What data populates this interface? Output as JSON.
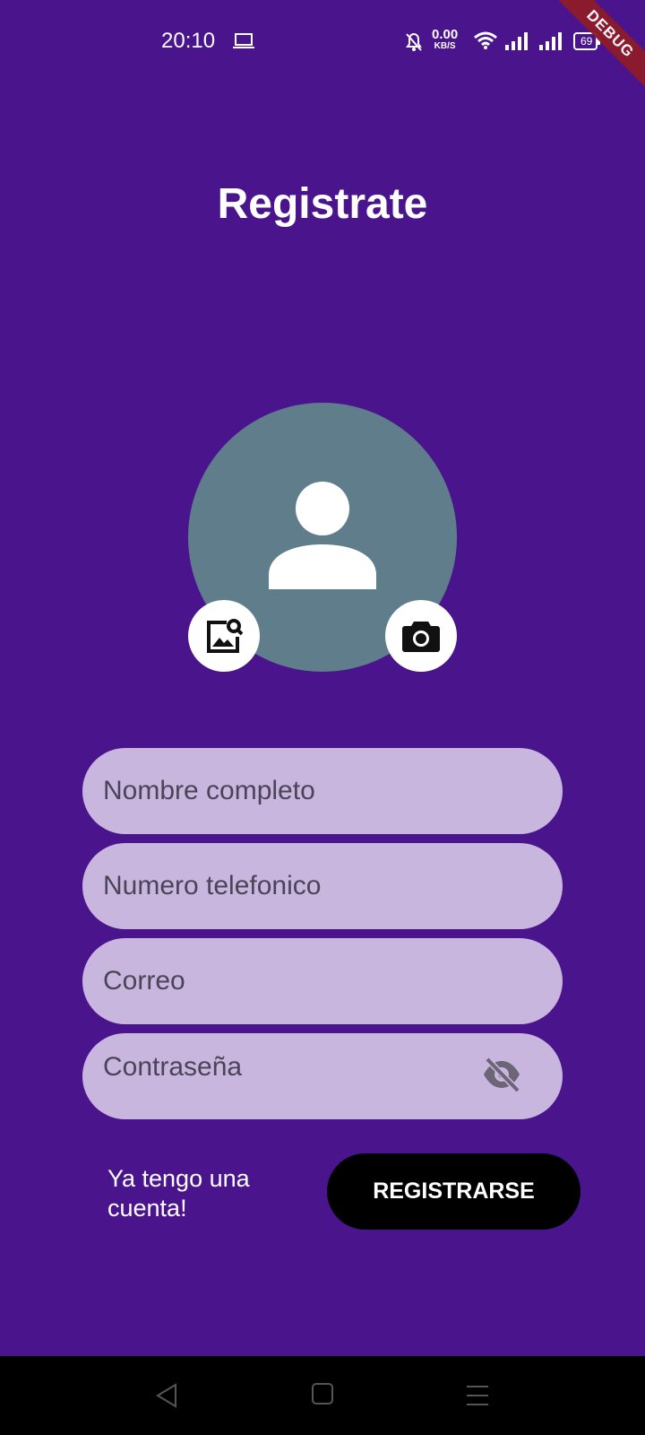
{
  "status_bar": {
    "time": "20:10",
    "net_speed_value": "0.00",
    "net_speed_unit": "KB/S",
    "battery": "69",
    "icons": [
      "laptop-icon",
      "bell-off-icon",
      "wifi-icon",
      "signal-icon",
      "signal-icon",
      "battery-icon"
    ]
  },
  "debug_banner": "DEBUG",
  "title": "Registrate",
  "avatar": {
    "icon": "person-icon",
    "gallery_icon": "image-search-icon",
    "camera_icon": "camera-icon"
  },
  "form": {
    "name_placeholder": "Nombre completo",
    "phone_placeholder": "Numero telefonico",
    "email_placeholder": "Correo",
    "password_placeholder": "Contraseña",
    "password_toggle_icon": "eye-off-icon"
  },
  "actions": {
    "login_link": "Ya tengo una cuenta!",
    "register_button": "REGISTRARSE"
  },
  "nav_bar": {
    "icons": [
      "back-icon",
      "home-icon",
      "menu-icon"
    ]
  },
  "colors": {
    "background": "#4a148c",
    "avatar": "#607d8b",
    "field": "#c9b6de",
    "button": "#000000",
    "debug_ribbon": "#8e1b2a"
  }
}
